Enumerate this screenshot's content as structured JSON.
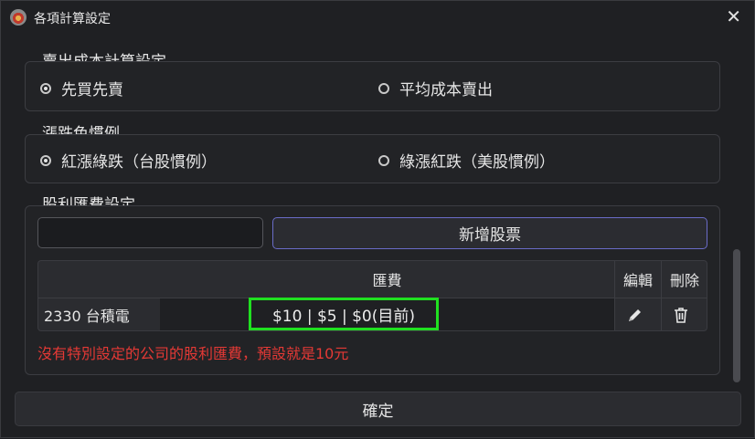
{
  "window": {
    "title": "各項計算設定",
    "close_glyph": "✕"
  },
  "sell_cost": {
    "label": "賣出成本計算設定",
    "options": [
      {
        "label": "先買先賣",
        "checked": true
      },
      {
        "label": "平均成本賣出",
        "checked": false
      }
    ]
  },
  "color_convention": {
    "label": "漲跌色慣例",
    "options": [
      {
        "label": "紅漲綠跌（台股慣例）",
        "checked": true
      },
      {
        "label": "綠漲紅跌（美股慣例）",
        "checked": false
      }
    ]
  },
  "dividend_fee": {
    "label": "股利匯費設定",
    "input_value": "",
    "add_button": "新增股票",
    "table": {
      "headers": {
        "fee": "匯費",
        "edit": "編輯",
        "delete": "刪除"
      },
      "rows": [
        {
          "stock": "2330 台積電",
          "fee": "$10 | $5 | $0(目前)"
        }
      ]
    },
    "note": "沒有特別設定的公司的股利匯費，預設就是10元"
  },
  "ok_button": "確定",
  "colors": {
    "accent": "#6a6cc8",
    "highlight": "#20e020",
    "warning": "#e53935"
  },
  "icons": {
    "app": "app-logo-icon",
    "edit": "pencil-icon",
    "delete": "trash-icon",
    "close": "close-icon"
  }
}
